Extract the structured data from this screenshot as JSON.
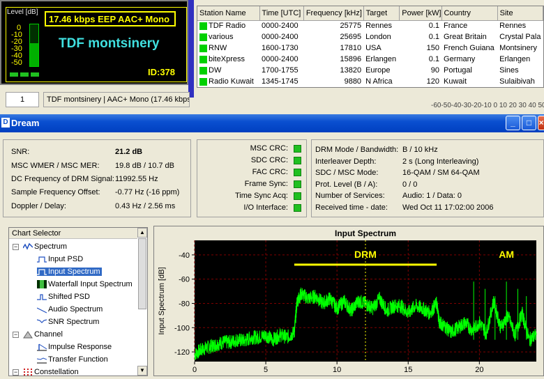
{
  "lcd": {
    "level_label": "Level [dB]",
    "level_ticks": [
      "0",
      "-10",
      "-20",
      "-30",
      "-40",
      "-50"
    ],
    "bitrate_text": "17.46 kbps EEP  AAC+ Mono",
    "station_name": "TDF montsinery",
    "id_text": "ID:378",
    "level_fraction": 0.55
  },
  "status": {
    "number": "1",
    "text": "TDF montsinery  |  AAC+ Mono (17.46 kbps"
  },
  "stations": {
    "columns": [
      "Station Name",
      "Time [UTC]",
      "Frequency [kHz]",
      "Target",
      "Power [kW]",
      "Country",
      "Site"
    ],
    "rows": [
      {
        "name": "TDF Radio",
        "time": "0000-2400",
        "freq": "25775",
        "target": "Rennes",
        "power": "0.1",
        "country": "France",
        "site": "Rennes"
      },
      {
        "name": "various",
        "time": "0000-2400",
        "freq": "25695",
        "target": "London",
        "power": "0.1",
        "country": "Great Britain",
        "site": "Crystal Pala"
      },
      {
        "name": "RNW",
        "time": "1600-1730",
        "freq": "17810",
        "target": "USA",
        "power": "150",
        "country": "French Guiana",
        "site": "Montsinery"
      },
      {
        "name": "biteXpress",
        "time": "0000-2400",
        "freq": "15896",
        "target": "Erlangen",
        "power": "0.1",
        "country": "Germany",
        "site": "Erlangen"
      },
      {
        "name": "DW",
        "time": "1700-1755",
        "freq": "13820",
        "target": "Europe",
        "power": "90",
        "country": "Portugal",
        "site": "Sines"
      },
      {
        "name": "Radio Kuwait",
        "time": "1345-1745",
        "freq": "9880",
        "target": "N Africa",
        "power": "120",
        "country": "Kuwait",
        "site": "Sulaibivah"
      }
    ],
    "scale_text": "-60-50-40-30-20-10 0 10 20 30 40 50"
  },
  "window": {
    "title": "Dream",
    "icon_letter": "D",
    "minimize": "_",
    "maximize": "□",
    "close": "×"
  },
  "signal": {
    "labels": [
      "SNR:",
      "MSC WMER / MSC MER:",
      "DC Frequency of DRM Signal:",
      "Sample Frequency Offset:",
      "Doppler / Delay:"
    ],
    "values": [
      "21.2 dB",
      "19.8 dB / 10.7 dB",
      "11992.55 Hz",
      "-0.77 Hz (-16 ppm)",
      "0.43 Hz / 2.56 ms"
    ]
  },
  "crc": {
    "labels": [
      "MSC CRC:",
      "SDC CRC:",
      "FAC CRC:",
      "Frame Sync:",
      "Time Sync Acq:",
      "I/O Interface:"
    ],
    "status_color": "#20c020"
  },
  "mode": {
    "labels": [
      "DRM Mode / Bandwidth:",
      "Interleaver Depth:",
      "SDC / MSC Mode:",
      "Prot. Level (B / A):",
      "Number of Services:",
      "Received time - date:"
    ],
    "values": [
      "B / 10 kHz",
      "2 s (Long Interleaving)",
      "16-QAM / SM 64-QAM",
      "0 / 0",
      "Audio: 1 / Data: 0",
      "Wed Oct 11 17:02:00 2006"
    ]
  },
  "selector": {
    "title": "Chart Selector",
    "items": [
      "Spectrum",
      "Input PSD",
      "Input Spectrum",
      "Waterfall Input Spectrum",
      "Shifted PSD",
      "Audio Spectrum",
      "SNR Spectrum",
      "Channel",
      "Impulse Response",
      "Transfer Function",
      "Constellation"
    ],
    "selected": "Input Spectrum"
  },
  "chart_data": {
    "type": "line",
    "title": "Input Spectrum",
    "ylabel": "Input Spectrum [dB]",
    "xlabel": "",
    "xlim": [
      0,
      24
    ],
    "ylim": [
      -128,
      -28
    ],
    "xticks": [
      0,
      5,
      10,
      15,
      20
    ],
    "yticks": [
      -40,
      -60,
      -80,
      -100,
      -120
    ],
    "grid": true,
    "series_color": "#00ff00",
    "marker_x": 12,
    "annotations": [
      {
        "text": "DRM",
        "x": 12,
        "y": -40,
        "span": [
          7,
          17
        ]
      },
      {
        "text": "AM",
        "x": 21.9,
        "y": -40
      }
    ],
    "x": [
      0,
      0.5,
      1,
      1.5,
      2,
      2.5,
      3,
      3.5,
      4,
      4.5,
      5,
      5.5,
      6,
      6.5,
      7,
      7.2,
      7.5,
      8,
      8.5,
      9,
      9.5,
      10,
      10.5,
      11,
      11.5,
      12,
      12.5,
      13,
      13.5,
      14,
      14.5,
      15,
      15.5,
      16,
      16.5,
      17,
      17.2,
      17.5,
      18,
      18.5,
      19,
      19.5,
      20,
      20.5,
      21,
      21.5,
      22,
      22.5,
      23,
      23.5,
      24
    ],
    "values": [
      -122,
      -118,
      -116,
      -114,
      -112,
      -112,
      -110,
      -111,
      -108,
      -108,
      -106,
      -110,
      -106,
      -108,
      -104,
      -78,
      -72,
      -76,
      -74,
      -80,
      -76,
      -84,
      -78,
      -86,
      -78,
      -80,
      -84,
      -76,
      -86,
      -82,
      -82,
      -88,
      -82,
      -84,
      -88,
      -80,
      -96,
      -98,
      -104,
      -100,
      -96,
      -102,
      -96,
      -104,
      -78,
      -100,
      -90,
      -106,
      -88,
      -110,
      -106
    ]
  }
}
